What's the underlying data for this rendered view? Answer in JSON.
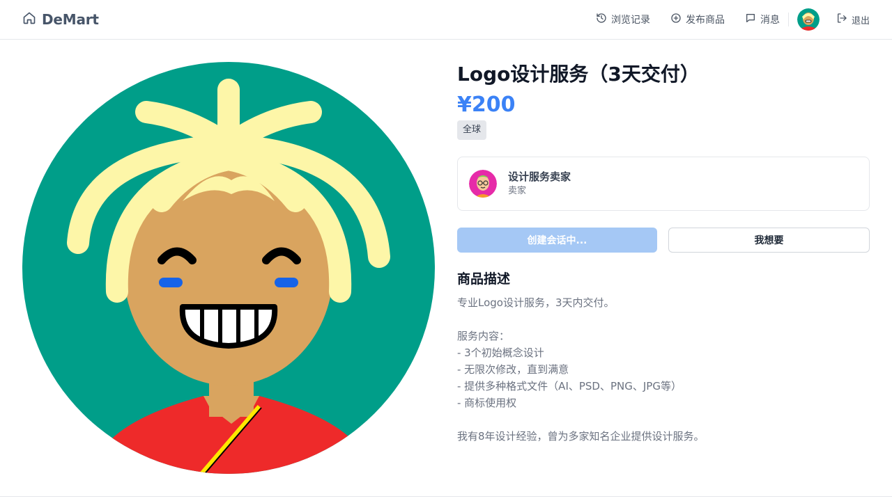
{
  "header": {
    "brand": "DeMart",
    "nav": {
      "history": "浏览记录",
      "publish": "发布商品",
      "messages": "消息",
      "logout": "退出"
    }
  },
  "product": {
    "title": "Logo设计服务（3天交付）",
    "price": "¥200",
    "region_tag": "全球"
  },
  "seller": {
    "name": "设计服务卖家",
    "role": "卖家"
  },
  "actions": {
    "primary": "创建会话中...",
    "secondary": "我想要"
  },
  "description": {
    "heading": "商品描述",
    "text": "专业Logo设计服务，3天内交付。\n\n服务内容：\n- 3个初始概念设计\n- 无限次修改，直到满意\n- 提供多种格式文件（AI、PSD、PNG、JPG等）\n- 商标使用权\n\n我有8年设计经验，曾为多家知名企业提供设计服务。"
  },
  "colors": {
    "accent": "#3b82f6",
    "primary_disabled": "#a5c8f5",
    "avatar_bg": "#009e89"
  },
  "icons": {
    "brand": "home-icon",
    "history": "history-icon",
    "publish": "plus-circle-icon",
    "messages": "message-icon",
    "logout": "logout-icon"
  }
}
